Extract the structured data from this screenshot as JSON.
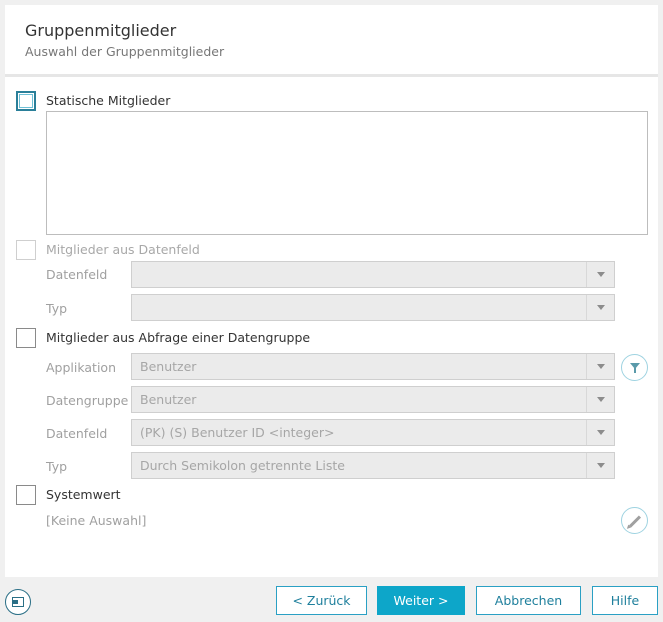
{
  "header": {
    "title": "Gruppenmitglieder",
    "subtitle": "Auswahl der Gruppenmitglieder"
  },
  "sections": {
    "static": {
      "label": "Statische Mitglieder",
      "checked": false
    },
    "datafield": {
      "label": "Mitglieder aus Datenfeld",
      "checked": false,
      "fields": [
        {
          "label": "Datenfeld",
          "value": ""
        },
        {
          "label": "Typ",
          "value": ""
        }
      ]
    },
    "query": {
      "label": "Mitglieder aus Abfrage einer Datengruppe",
      "checked": false,
      "fields": [
        {
          "label": "Applikation",
          "value": "Benutzer"
        },
        {
          "label": "Datengruppe",
          "value": "Benutzer"
        },
        {
          "label": "Datenfeld",
          "value": "(PK) (S) Benutzer ID <integer>"
        },
        {
          "label": "Typ",
          "value": "Durch Semikolon getrennte Liste"
        }
      ]
    },
    "system": {
      "label": "Systemwert",
      "checked": false,
      "value": "[Keine Auswahl]"
    }
  },
  "footer": {
    "back_label": "< Zurück",
    "next_label": "Weiter >",
    "cancel_label": "Abbrechen",
    "help_label": "Hilfe"
  },
  "colors": {
    "accent": "#0da6c9",
    "accent_border": "#2aa0c4",
    "disabled_field_bg": "#ebebeb"
  },
  "icons": {
    "filter": "filter-icon",
    "edit": "pencil-icon",
    "window": "window-icon",
    "dropdown": "chevron-down-icon"
  }
}
